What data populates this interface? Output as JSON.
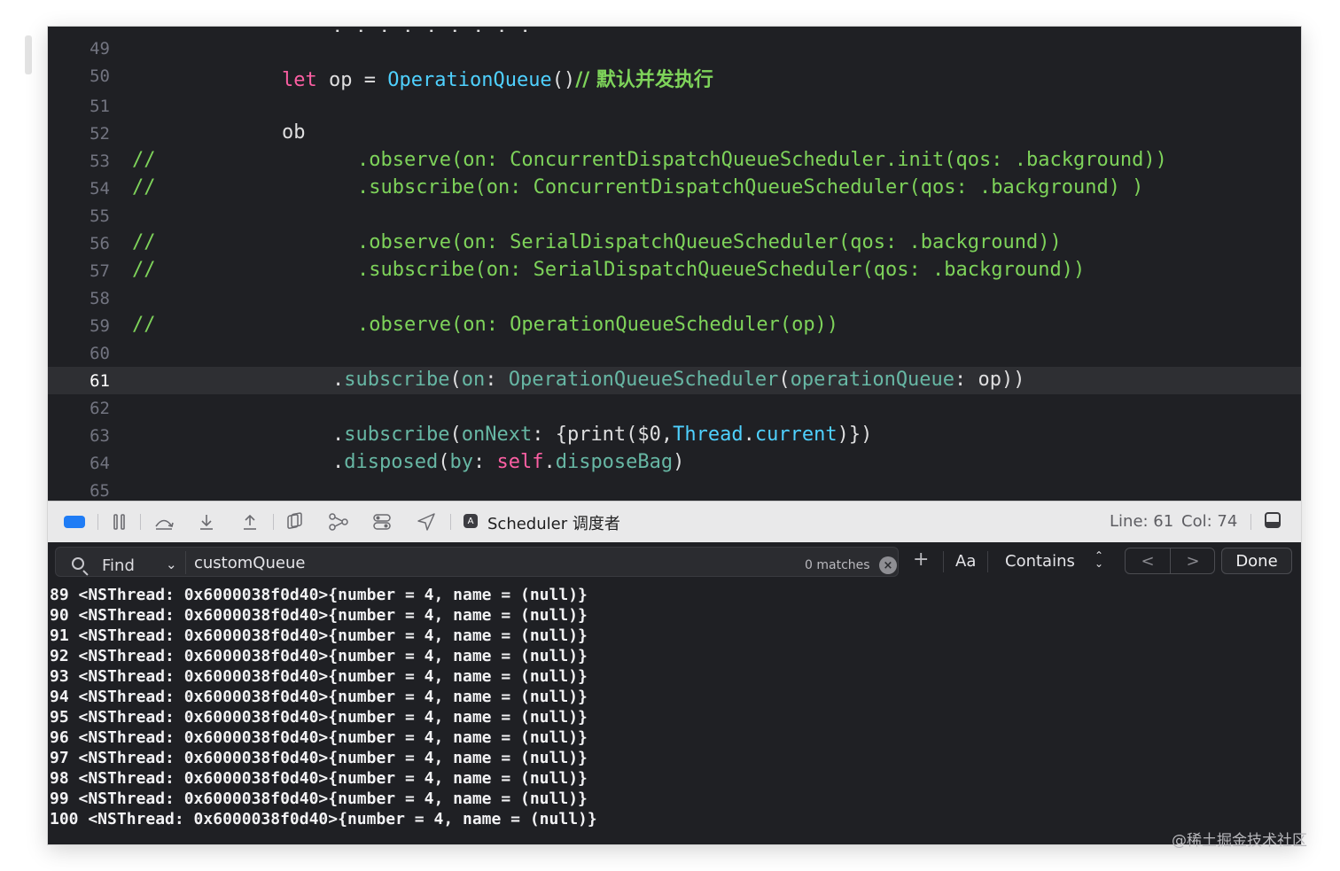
{
  "editor": {
    "partial_top_line": ", , , , , , , , ,",
    "lines": [
      {
        "num": "49",
        "text": ""
      },
      {
        "num": "50",
        "kw": "let",
        "name": "op",
        "eq": " = ",
        "type": "OperationQueue",
        "paren": "()",
        "comment": "// 默认并发执行"
      },
      {
        "num": "51",
        "text": ""
      },
      {
        "num": "52",
        "text": "ob"
      },
      {
        "num": "53",
        "comment_mark": "//",
        "text": ".observe(on: ConcurrentDispatchQueueScheduler.init(qos: .background))"
      },
      {
        "num": "54",
        "comment_mark": "//",
        "text": ".subscribe(on: ConcurrentDispatchQueueScheduler(qos: .background) )"
      },
      {
        "num": "55",
        "text": ""
      },
      {
        "num": "56",
        "comment_mark": "//",
        "text": ".observe(on: SerialDispatchQueueScheduler(qos: .background))"
      },
      {
        "num": "57",
        "comment_mark": "//",
        "text": ".subscribe(on: SerialDispatchQueueScheduler(qos: .background))"
      },
      {
        "num": "58",
        "text": ""
      },
      {
        "num": "59",
        "comment_mark": "//",
        "text": ".observe(on: OperationQueueScheduler(op))"
      },
      {
        "num": "60",
        "text": ""
      },
      {
        "num": "61",
        "current": true
      },
      {
        "num": "62",
        "text": ""
      },
      {
        "num": "63"
      },
      {
        "num": "64"
      },
      {
        "num": "65",
        "text": ""
      }
    ],
    "line61": {
      "dot": ".",
      "method": "subscribe",
      "p1": "(",
      "arg": "on",
      "colon": ": ",
      "type": "OperationQueueScheduler",
      "p2": "(",
      "param": "operationQueue",
      "colon2": ": ",
      "var": "op",
      "p3": "))"
    },
    "line63": {
      "dot": ".",
      "method": "subscribe",
      "p1": "(",
      "arg": "onNext",
      "colon": ": ",
      "body": "{print($0,",
      "type": "Thread",
      "dot2": ".",
      "prop": "current",
      "end": ")})"
    },
    "line64": {
      "dot": ".",
      "method": "disposed",
      "p1": "(",
      "arg": "by",
      "colon": ": ",
      "kw": "self",
      "dot2": ".",
      "prop": "disposeBag",
      "end": ")"
    }
  },
  "debug_bar": {
    "icons": [
      "breakpoints-toggle-icon",
      "pause-icon",
      "step-over-icon",
      "step-into-icon",
      "step-out-icon",
      "view-hierarchy-icon",
      "memory-graph-icon",
      "environment-overrides-icon",
      "location-icon"
    ],
    "accent": "#1f7cf5",
    "scheme_icon": "A",
    "scheme_name": "Scheduler 调度者",
    "line_label": "Line: 61",
    "col_label": "Col: 74"
  },
  "find_bar": {
    "mode_label": "Find",
    "query": "customQueue",
    "matches": "0 matches",
    "clear_glyph": "×",
    "add_glyph": "+",
    "case_label": "Aa",
    "match_mode": "Contains",
    "prev_glyph": "<",
    "next_glyph": ">",
    "done_label": "Done"
  },
  "console": {
    "lines": [
      "89 <NSThread: 0x6000038f0d40>{number = 4, name = (null)}",
      "90 <NSThread: 0x6000038f0d40>{number = 4, name = (null)}",
      "91 <NSThread: 0x6000038f0d40>{number = 4, name = (null)}",
      "92 <NSThread: 0x6000038f0d40>{number = 4, name = (null)}",
      "93 <NSThread: 0x6000038f0d40>{number = 4, name = (null)}",
      "94 <NSThread: 0x6000038f0d40>{number = 4, name = (null)}",
      "95 <NSThread: 0x6000038f0d40>{number = 4, name = (null)}",
      "96 <NSThread: 0x6000038f0d40>{number = 4, name = (null)}",
      "97 <NSThread: 0x6000038f0d40>{number = 4, name = (null)}",
      "98 <NSThread: 0x6000038f0d40>{number = 4, name = (null)}",
      "99 <NSThread: 0x6000038f0d40>{number = 4, name = (null)}",
      "100 <NSThread: 0x6000038f0d40>{number = 4, name = (null)}"
    ]
  },
  "watermark": "@稀土掘金技术社区"
}
